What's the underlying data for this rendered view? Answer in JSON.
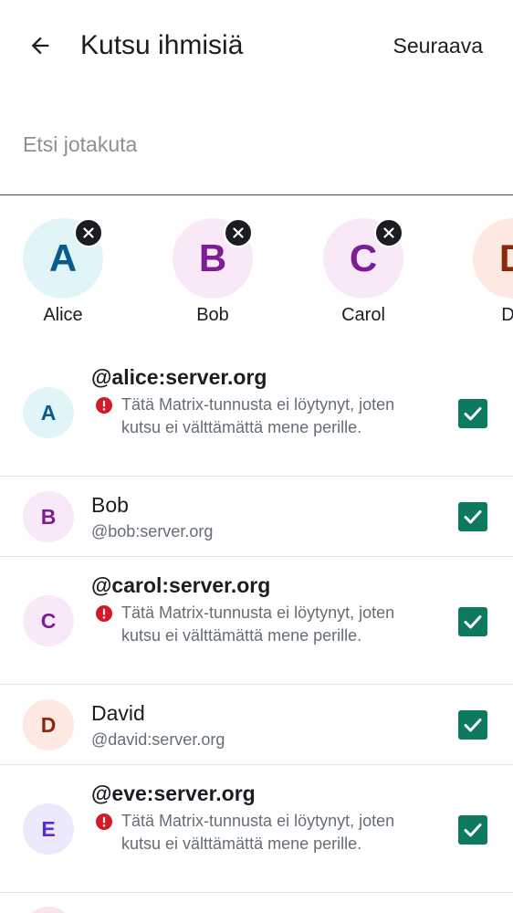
{
  "header": {
    "title": "Kutsu ihmisiä",
    "next_label": "Seuraava",
    "back_icon": "arrow-left-icon"
  },
  "search": {
    "placeholder": "Etsi jotakuta"
  },
  "selected": [
    {
      "initial": "A",
      "name": "Alice",
      "bg": "#e1f4f8",
      "fg": "#0a5a8c"
    },
    {
      "initial": "B",
      "name": "Bob",
      "bg": "#f9e8f8",
      "fg": "#7b1e91"
    },
    {
      "initial": "C",
      "name": "Carol",
      "bg": "#f9e8f8",
      "fg": "#7b1e91"
    },
    {
      "initial": "D",
      "name": "Da",
      "bg": "#fde9e1",
      "fg": "#8a2a0a"
    }
  ],
  "users": [
    {
      "initial": "A",
      "primary": "@alice:server.org",
      "warning": "Tätä Matrix-tunnusta ei löytynyt, joten kutsu ei välttämättä mene perille.",
      "bg": "#e1f4f8",
      "fg": "#0a5a8c",
      "checked": true
    },
    {
      "initial": "B",
      "primary": "Bob",
      "secondary": "@bob:server.org",
      "bg": "#f9e8f8",
      "fg": "#7b1e91",
      "checked": true
    },
    {
      "initial": "C",
      "primary": "@carol:server.org",
      "warning": "Tätä Matrix-tunnusta ei löytynyt, joten kutsu ei välttämättä mene perille.",
      "bg": "#f9e8f8",
      "fg": "#7b1e91",
      "checked": true
    },
    {
      "initial": "D",
      "primary": "David",
      "secondary": "@david:server.org",
      "bg": "#fde9e1",
      "fg": "#8a2a0a",
      "checked": true
    },
    {
      "initial": "E",
      "primary": "@eve:server.org",
      "warning": "Tätä Matrix-tunnusta ei löytynyt, joten kutsu ei välttämättä mene perille.",
      "bg": "#ece9fc",
      "fg": "#5a2bd0",
      "checked": true
    }
  ],
  "colors": {
    "checkbox": "#0d7a5f",
    "warning": "#d51928"
  }
}
